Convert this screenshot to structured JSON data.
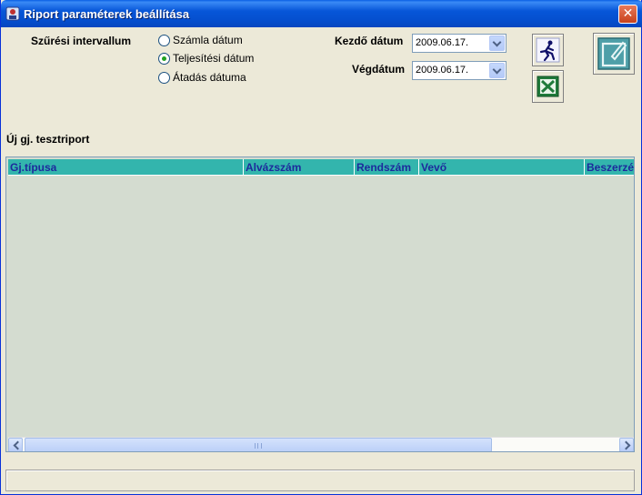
{
  "window": {
    "title": "Riport paraméterek beállítása",
    "close_label": "✕"
  },
  "filter": {
    "label": "Szűrési intervallum",
    "options": [
      {
        "label": "Számla dátum",
        "checked": false
      },
      {
        "label": "Teljesítési dátum",
        "checked": true
      },
      {
        "label": "Átadás dátuma",
        "checked": false
      }
    ]
  },
  "dates": {
    "start_label": "Kezdő dátum",
    "start_value": "2009.06.17.",
    "end_label": "Végdátum",
    "end_value": "2009.06.17."
  },
  "toolbar": {
    "run_icon": "running-man-icon",
    "excel_icon": "excel-icon",
    "edit_icon": "edit-icon"
  },
  "report": {
    "title": "Új gj. tesztriport"
  },
  "grid": {
    "columns": [
      "Gj.típusa",
      "Alvázszám",
      "Rendszám",
      "Vevő",
      "Beszerzé"
    ],
    "rows": []
  },
  "colors": {
    "header_bg": "#33b5ad",
    "header_text": "#1d2a9c",
    "grid_bg": "#d4dcd0",
    "titlebar": "#0756d8"
  }
}
